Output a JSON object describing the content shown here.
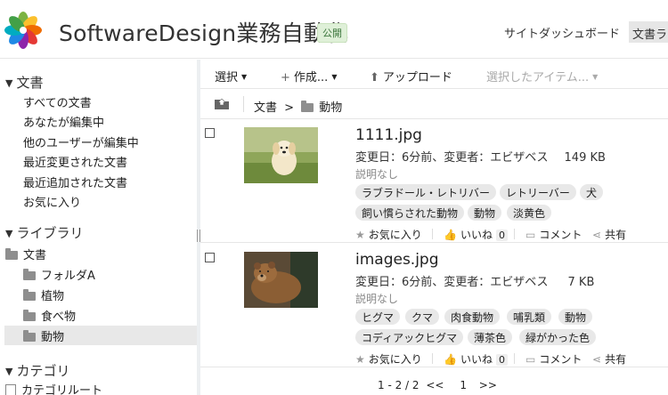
{
  "header": {
    "title": "SoftwareDesign業務自動化",
    "badge": "公開",
    "dashboard_link": "サイトダッシュボード",
    "doc_tab": "文書ライブラリ"
  },
  "sidebar": {
    "documents": {
      "title": "文書",
      "items": [
        "すべての文書",
        "あなたが編集中",
        "他のユーザーが編集中",
        "最近変更された文書",
        "最近追加された文書",
        "お気に入り"
      ]
    },
    "library": {
      "title": "ライブラリ",
      "root": "文書",
      "folders": [
        "フォルダA",
        "植物",
        "食べ物",
        "動物"
      ]
    },
    "categories": {
      "title": "カテゴリ",
      "root": "カテゴリルート"
    }
  },
  "toolbar": {
    "select": "選択",
    "create": "作成...",
    "upload": "アップロード",
    "selected_items": "選択したアイテム..."
  },
  "breadcrumb": {
    "root": "文書",
    "separator": ">",
    "current": "動物"
  },
  "documents": [
    {
      "name": "1111.jpg",
      "meta": "変更日：6分前、変更者：エビザベス",
      "size": "149 KB",
      "description": "説明なし",
      "tags": [
        "ラブラドール・レトリバー",
        "レトリーバー",
        "犬",
        "飼い慣らされた動物",
        "動物",
        "淡黄色"
      ],
      "favorite": "お気に入り",
      "like": "いいね",
      "like_count": "0",
      "comment": "コメント",
      "share": "共有"
    },
    {
      "name": "images.jpg",
      "meta": "変更日：6分前、変更者：エビザベス",
      "size": "7 KB",
      "description": "説明なし",
      "tags": [
        "ヒグマ",
        "クマ",
        "肉食動物",
        "哺乳類",
        "動物",
        "コディアックヒグマ",
        "薄茶色",
        "緑がかった色"
      ],
      "favorite": "お気に入り",
      "like": "いいね",
      "like_count": "0",
      "comment": "コメント",
      "share": "共有"
    }
  ],
  "pagination": {
    "range": "1 - 2 / 2",
    "prev": "<<",
    "page": "1",
    "next": ">>"
  },
  "colors": {
    "badge_bg": "#dff0d8",
    "tag_bg": "#e8e8e8",
    "selected_row": "#e8e8e8"
  }
}
